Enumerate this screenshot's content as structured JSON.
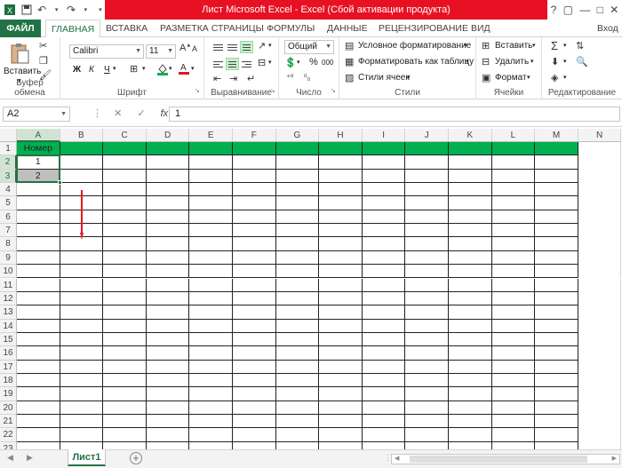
{
  "window": {
    "title": "Лист Microsoft Excel -  Excel (Сбой активации продукта)",
    "controls": [
      "?",
      "▢",
      "—",
      "□",
      "✕"
    ]
  },
  "tabs": [
    {
      "label": "ФАЙЛ"
    },
    {
      "label": "ГЛАВНАЯ"
    },
    {
      "label": "ВСТАВКА"
    },
    {
      "label": "РАЗМЕТКА СТРАНИЦЫ"
    },
    {
      "label": "ФОРМУЛЫ"
    },
    {
      "label": "ДАННЫЕ"
    },
    {
      "label": "РЕЦЕНЗИРОВАНИЕ"
    },
    {
      "label": "ВИД"
    },
    {
      "label": "Вход"
    }
  ],
  "ribbon": {
    "clipboard": {
      "paste": "Вставить",
      "group": "Буфер обмена"
    },
    "font": {
      "name": "Calibri",
      "size": "11",
      "bold": "Ж",
      "italic": "К",
      "underline": "Ч",
      "group": "Шрифт"
    },
    "alignment": {
      "group": "Выравнивание"
    },
    "number": {
      "format": "Общий",
      "percent": "%",
      "thousands": "000",
      "group": "Число"
    },
    "styles": {
      "conditional": "Условное форматирование",
      "table": "Форматировать как таблицу",
      "cell": "Стили ячеек",
      "group": "Стили"
    },
    "cells": {
      "insert": "Вставить",
      "delete": "Удалить",
      "format": "Формат",
      "group": "Ячейки"
    },
    "editing": {
      "group": "Редактирование"
    }
  },
  "formula_bar": {
    "name_box": "A2",
    "value": "1",
    "fx": "fx"
  },
  "grid": {
    "columns": [
      "A",
      "B",
      "C",
      "D",
      "E",
      "F",
      "G",
      "H",
      "I",
      "J",
      "K",
      "L",
      "M",
      "N"
    ],
    "rows": [
      "1",
      "2",
      "3",
      "4",
      "5",
      "6",
      "7",
      "8",
      "9",
      "10",
      "11",
      "12",
      "13",
      "14",
      "15",
      "16",
      "17",
      "18",
      "19",
      "20",
      "21",
      "22",
      "23"
    ],
    "cells": {
      "A1": "Номер",
      "A2": "1",
      "A3": "2"
    }
  },
  "sheets": {
    "active": "Лист1"
  },
  "colors": {
    "accent": "#217346",
    "header_fill": "#00b050",
    "selection_fill": "#bfbfbf",
    "title_bar": "#e81123",
    "arrow": "#e8181e"
  }
}
